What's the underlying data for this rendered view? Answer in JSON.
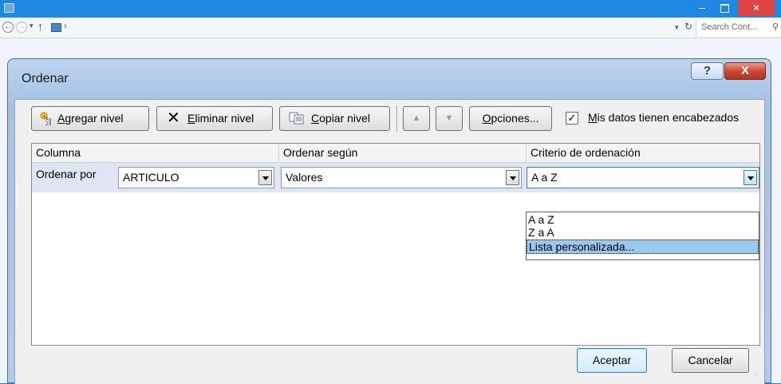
{
  "explorer": {
    "search_placeholder": "Search Cont...",
    "minimize_glyph": "–",
    "close_glyph": "×"
  },
  "dialog": {
    "title": "Ordenar",
    "help_glyph": "?",
    "close_glyph": "X",
    "toolbar": {
      "add_level_underlined": "A",
      "add_level_rest": "gregar nivel",
      "delete_level_underlined": "E",
      "delete_level_rest": "liminar nivel",
      "copy_level_underlined": "C",
      "copy_level_rest": "opiar nivel",
      "move_up_glyph": "▲",
      "move_down_glyph": "▼",
      "options_underlined": "O",
      "options_rest": "pciones...",
      "headers_checkbox_checked": true,
      "headers_label_underlined": "M",
      "headers_label_rest": "is datos tienen encabezados"
    },
    "grid": {
      "columns": [
        "Columna",
        "Ordenar según",
        "Criterio de ordenación"
      ],
      "rows": [
        {
          "label": "Ordenar por",
          "column": "ARTICULO",
          "sort_on": "Valores",
          "order": "A a Z"
        }
      ]
    },
    "order_dropdown": {
      "options": [
        "A a Z",
        "Z a A",
        "Lista personalizada..."
      ],
      "highlighted": "Lista personalizada..."
    },
    "footer": {
      "accept_label": "Aceptar",
      "cancel_label": "Cancelar"
    }
  },
  "colors": {
    "dialog_frame": "#b3cbe9",
    "selection": "#99c9ef",
    "close_red": "#c7452f"
  }
}
